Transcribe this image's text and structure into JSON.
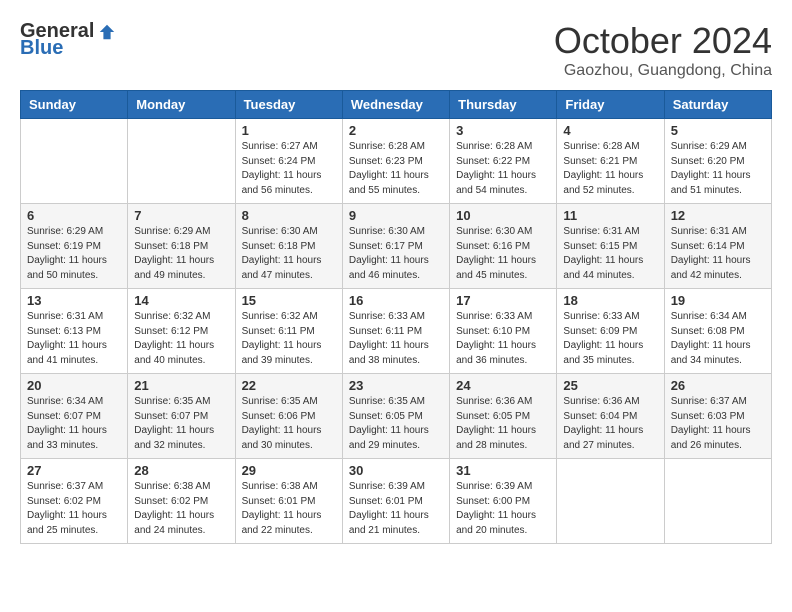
{
  "logo": {
    "general": "General",
    "blue": "Blue"
  },
  "header": {
    "month": "October 2024",
    "location": "Gaozhou, Guangdong, China"
  },
  "days_of_week": [
    "Sunday",
    "Monday",
    "Tuesday",
    "Wednesday",
    "Thursday",
    "Friday",
    "Saturday"
  ],
  "weeks": [
    [
      {
        "day": "",
        "info": ""
      },
      {
        "day": "",
        "info": ""
      },
      {
        "day": "1",
        "info": "Sunrise: 6:27 AM\nSunset: 6:24 PM\nDaylight: 11 hours and 56 minutes."
      },
      {
        "day": "2",
        "info": "Sunrise: 6:28 AM\nSunset: 6:23 PM\nDaylight: 11 hours and 55 minutes."
      },
      {
        "day": "3",
        "info": "Sunrise: 6:28 AM\nSunset: 6:22 PM\nDaylight: 11 hours and 54 minutes."
      },
      {
        "day": "4",
        "info": "Sunrise: 6:28 AM\nSunset: 6:21 PM\nDaylight: 11 hours and 52 minutes."
      },
      {
        "day": "5",
        "info": "Sunrise: 6:29 AM\nSunset: 6:20 PM\nDaylight: 11 hours and 51 minutes."
      }
    ],
    [
      {
        "day": "6",
        "info": "Sunrise: 6:29 AM\nSunset: 6:19 PM\nDaylight: 11 hours and 50 minutes."
      },
      {
        "day": "7",
        "info": "Sunrise: 6:29 AM\nSunset: 6:18 PM\nDaylight: 11 hours and 49 minutes."
      },
      {
        "day": "8",
        "info": "Sunrise: 6:30 AM\nSunset: 6:18 PM\nDaylight: 11 hours and 47 minutes."
      },
      {
        "day": "9",
        "info": "Sunrise: 6:30 AM\nSunset: 6:17 PM\nDaylight: 11 hours and 46 minutes."
      },
      {
        "day": "10",
        "info": "Sunrise: 6:30 AM\nSunset: 6:16 PM\nDaylight: 11 hours and 45 minutes."
      },
      {
        "day": "11",
        "info": "Sunrise: 6:31 AM\nSunset: 6:15 PM\nDaylight: 11 hours and 44 minutes."
      },
      {
        "day": "12",
        "info": "Sunrise: 6:31 AM\nSunset: 6:14 PM\nDaylight: 11 hours and 42 minutes."
      }
    ],
    [
      {
        "day": "13",
        "info": "Sunrise: 6:31 AM\nSunset: 6:13 PM\nDaylight: 11 hours and 41 minutes."
      },
      {
        "day": "14",
        "info": "Sunrise: 6:32 AM\nSunset: 6:12 PM\nDaylight: 11 hours and 40 minutes."
      },
      {
        "day": "15",
        "info": "Sunrise: 6:32 AM\nSunset: 6:11 PM\nDaylight: 11 hours and 39 minutes."
      },
      {
        "day": "16",
        "info": "Sunrise: 6:33 AM\nSunset: 6:11 PM\nDaylight: 11 hours and 38 minutes."
      },
      {
        "day": "17",
        "info": "Sunrise: 6:33 AM\nSunset: 6:10 PM\nDaylight: 11 hours and 36 minutes."
      },
      {
        "day": "18",
        "info": "Sunrise: 6:33 AM\nSunset: 6:09 PM\nDaylight: 11 hours and 35 minutes."
      },
      {
        "day": "19",
        "info": "Sunrise: 6:34 AM\nSunset: 6:08 PM\nDaylight: 11 hours and 34 minutes."
      }
    ],
    [
      {
        "day": "20",
        "info": "Sunrise: 6:34 AM\nSunset: 6:07 PM\nDaylight: 11 hours and 33 minutes."
      },
      {
        "day": "21",
        "info": "Sunrise: 6:35 AM\nSunset: 6:07 PM\nDaylight: 11 hours and 32 minutes."
      },
      {
        "day": "22",
        "info": "Sunrise: 6:35 AM\nSunset: 6:06 PM\nDaylight: 11 hours and 30 minutes."
      },
      {
        "day": "23",
        "info": "Sunrise: 6:35 AM\nSunset: 6:05 PM\nDaylight: 11 hours and 29 minutes."
      },
      {
        "day": "24",
        "info": "Sunrise: 6:36 AM\nSunset: 6:05 PM\nDaylight: 11 hours and 28 minutes."
      },
      {
        "day": "25",
        "info": "Sunrise: 6:36 AM\nSunset: 6:04 PM\nDaylight: 11 hours and 27 minutes."
      },
      {
        "day": "26",
        "info": "Sunrise: 6:37 AM\nSunset: 6:03 PM\nDaylight: 11 hours and 26 minutes."
      }
    ],
    [
      {
        "day": "27",
        "info": "Sunrise: 6:37 AM\nSunset: 6:02 PM\nDaylight: 11 hours and 25 minutes."
      },
      {
        "day": "28",
        "info": "Sunrise: 6:38 AM\nSunset: 6:02 PM\nDaylight: 11 hours and 24 minutes."
      },
      {
        "day": "29",
        "info": "Sunrise: 6:38 AM\nSunset: 6:01 PM\nDaylight: 11 hours and 22 minutes."
      },
      {
        "day": "30",
        "info": "Sunrise: 6:39 AM\nSunset: 6:01 PM\nDaylight: 11 hours and 21 minutes."
      },
      {
        "day": "31",
        "info": "Sunrise: 6:39 AM\nSunset: 6:00 PM\nDaylight: 11 hours and 20 minutes."
      },
      {
        "day": "",
        "info": ""
      },
      {
        "day": "",
        "info": ""
      }
    ]
  ]
}
